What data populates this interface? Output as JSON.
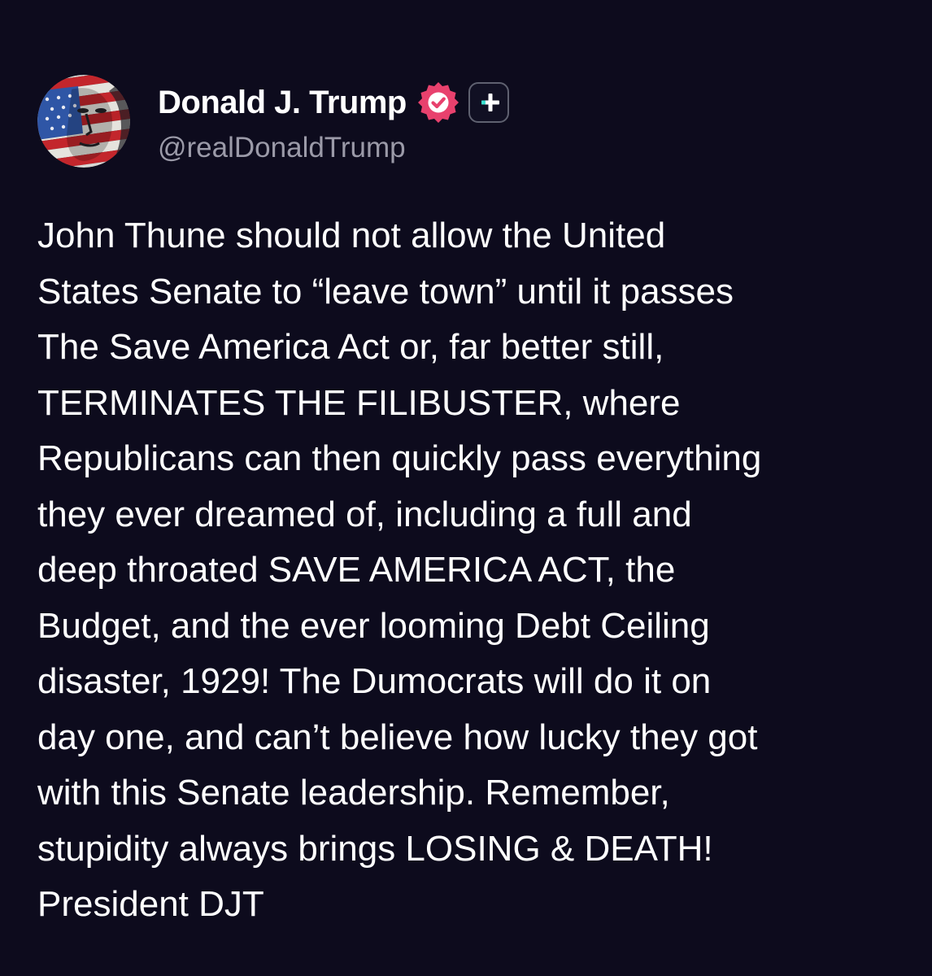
{
  "post": {
    "author": {
      "display_name": "Donald J. Trump",
      "handle": "@realDonaldTrump",
      "verified": true,
      "verified_color": "#e8416d",
      "avatar_icon": "flag-painted-portrait-avatar",
      "badge_icon": "plus-badge-icon"
    },
    "body_lines": [
      "John Thune should not allow the United",
      "States Senate to “leave town” until it passes",
      "The Save America Act or, far better still,",
      "TERMINATES THE FILIBUSTER, where",
      "Republicans can then quickly pass everything",
      "they ever dreamed of, including a full and",
      "deep throated SAVE AMERICA ACT, the",
      "Budget, and the ever looming Debt Ceiling",
      "disaster, 1929! The Dumocrats will do it on",
      "day one, and can’t believe how lucky they got",
      "with this Senate leadership. Remember,",
      "stupidity always brings LOSING & DEATH!",
      "President DJT"
    ]
  },
  "colors": {
    "background": "#0d0b1d",
    "text": "#ffffff",
    "handle": "#9b9aa8",
    "badge_accent": "#3be0d0"
  }
}
